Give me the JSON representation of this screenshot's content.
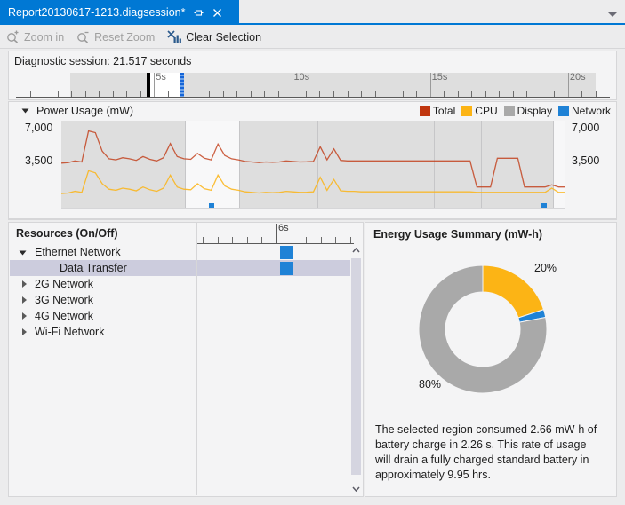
{
  "window": {
    "tab_title": "Report20130617-1213.diagsession*",
    "pin_icon": "pin-icon",
    "close_icon": "close-icon",
    "chevron_icon": "chevron-down-icon"
  },
  "toolbar": {
    "zoom_in_label": "Zoom in",
    "zoom_in_icon": "zoom-in-icon",
    "reset_zoom_label": "Reset Zoom",
    "reset_zoom_icon": "zoom-reset-icon",
    "clear_selection_label": "Clear Selection",
    "clear_selection_icon": "clear-selection-icon"
  },
  "session": {
    "label": "Diagnostic session: 21.517 seconds",
    "ruler_ticks": [
      "5s",
      "10s",
      "15s",
      "20s"
    ],
    "selection_start_label": "5s",
    "total_seconds": 21.517
  },
  "power": {
    "title": "Power Usage (mW)",
    "expander_icon": "triangle-expanded-icon",
    "y_axis_left": [
      "7,000",
      "3,500"
    ],
    "y_axis_right": [
      "7,000",
      "3,500"
    ],
    "legend": [
      {
        "label": "Total",
        "color": "#c0360f"
      },
      {
        "label": "CPU",
        "color": "#fcb415"
      },
      {
        "label": "Display",
        "color": "#a9a9a9"
      },
      {
        "label": "Network",
        "color": "#1f82d6"
      }
    ]
  },
  "resources": {
    "title": "Resources (On/Off)",
    "ruler_tick_label": "6s",
    "items": [
      {
        "label": "Ethernet Network",
        "state": "expanded",
        "indent": 0,
        "selected": false,
        "has_block": true
      },
      {
        "label": "Data Transfer",
        "state": "leaf",
        "indent": 1,
        "selected": true,
        "has_block": true
      },
      {
        "label": "2G Network",
        "state": "collapsed",
        "indent": 0,
        "selected": false,
        "has_block": false
      },
      {
        "label": "3G Network",
        "state": "collapsed",
        "indent": 0,
        "selected": false,
        "has_block": false
      },
      {
        "label": "4G Network",
        "state": "collapsed",
        "indent": 0,
        "selected": false,
        "has_block": false
      },
      {
        "label": "Wi-Fi Network",
        "state": "collapsed",
        "indent": 0,
        "selected": false,
        "has_block": false
      }
    ],
    "scroll_up_icon": "chevron-up-icon",
    "scroll_down_icon": "chevron-down-icon"
  },
  "energy": {
    "title": "Energy Usage Summary (mW-h)",
    "label_top": "20%",
    "label_bottom": "80%",
    "description": "The selected region consumed 2.66 mW-h of battery charge in 2.26 s. This rate of usage will drain a fully charged standard battery in approximately 9.95 hrs."
  },
  "chart_data": [
    {
      "type": "line",
      "title": "Power Usage (mW)",
      "xlabel": "",
      "ylabel": "mW",
      "ylim": [
        0,
        8000
      ],
      "yticks": [
        3500,
        7000
      ],
      "grid": true,
      "legend_position": "top-right",
      "series": [
        {
          "name": "Total",
          "color": "#c0360f",
          "values": [
            4100,
            4150,
            4300,
            4200,
            7050,
            6900,
            5200,
            4500,
            4400,
            4600,
            4500,
            4350,
            4700,
            4450,
            4300,
            4600,
            5900,
            4700,
            4500,
            4450,
            5000,
            4550,
            4400,
            5850,
            4800,
            4500,
            4400,
            4250,
            4200,
            4150,
            4200,
            4180,
            4200,
            4300,
            4250,
            4200,
            4220,
            4250,
            5600,
            4400,
            5400,
            4350,
            4300,
            4300,
            4300,
            4300,
            4300,
            4300,
            4300,
            4300,
            4300,
            4300,
            4300,
            4300,
            4300,
            4300,
            4300,
            4300,
            4300,
            4300,
            4300,
            1900,
            1900,
            1900,
            4550,
            4550,
            4550,
            4550,
            1900,
            1900,
            1900,
            1900,
            2100,
            1900,
            1900
          ]
        },
        {
          "name": "CPU",
          "color": "#fcb415",
          "values": [
            1300,
            1350,
            1500,
            1400,
            3400,
            3200,
            2200,
            1700,
            1600,
            1800,
            1700,
            1550,
            1900,
            1650,
            1500,
            1800,
            3000,
            1900,
            1700,
            1650,
            2200,
            1750,
            1600,
            3000,
            2000,
            1700,
            1600,
            1450,
            1400,
            1350,
            1400,
            1380,
            1400,
            1500,
            1450,
            1400,
            1420,
            1450,
            2800,
            1600,
            2600,
            1550,
            1500,
            1500,
            1450,
            1450,
            1450,
            1450,
            1450,
            1450,
            1450,
            1450,
            1450,
            1450,
            1450,
            1450,
            1450,
            1450,
            1450,
            1450,
            1450,
            1400,
            1400,
            1400,
            1400,
            1400,
            1400,
            1400,
            1400,
            1400,
            1400,
            1400,
            1800,
            1400,
            1400
          ]
        }
      ],
      "selection_region": {
        "start_pct": 24.5,
        "end_pct": 35.5
      }
    },
    {
      "type": "pie",
      "variant": "donut",
      "title": "Energy Usage Summary (mW-h)",
      "categories": [
        "CPU",
        "Network",
        "Display"
      ],
      "values": [
        20,
        2,
        78
      ],
      "labels": [
        "20%",
        "",
        "80%"
      ],
      "colors": [
        "#fcb415",
        "#1f82d6",
        "#a9a9a9"
      ],
      "legend_position": "none"
    }
  ]
}
